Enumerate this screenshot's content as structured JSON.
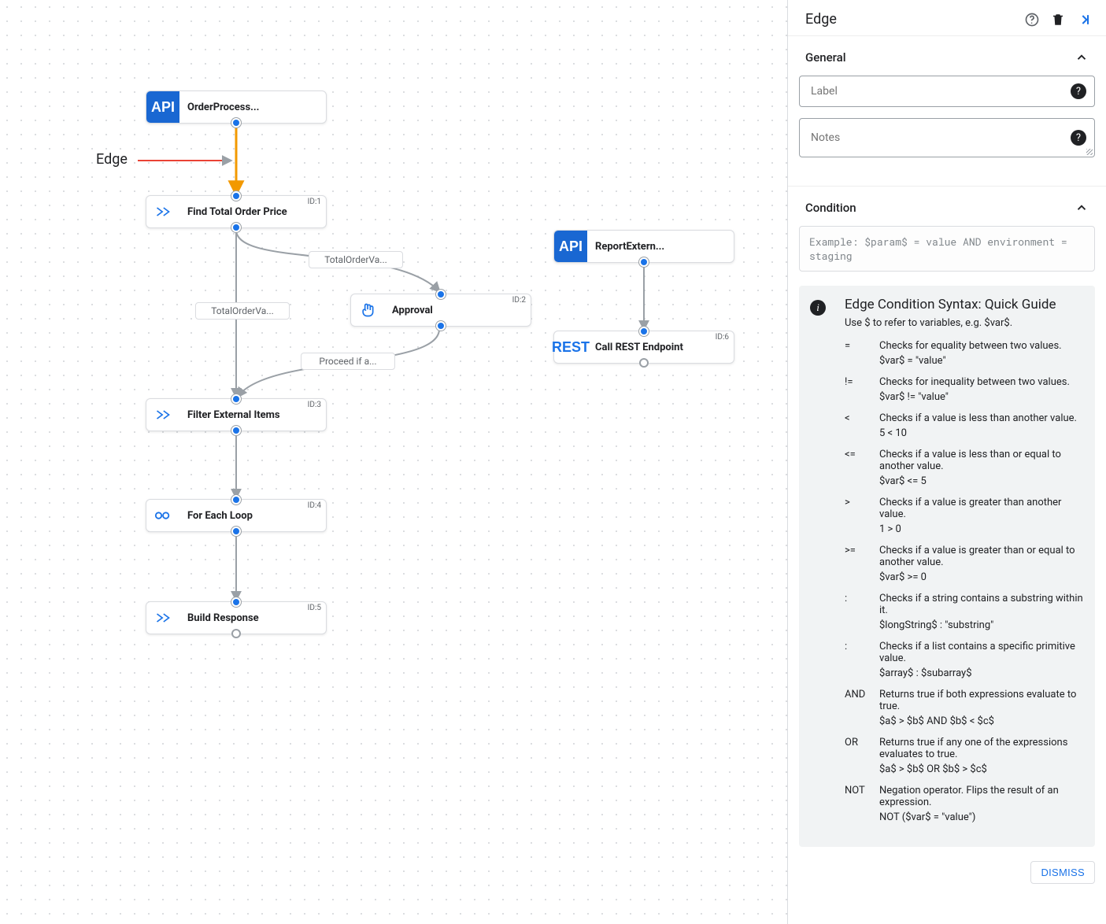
{
  "canvas": {
    "callout": "Edge",
    "nodes": {
      "order": {
        "label": "OrderProcess...",
        "kind": "api"
      },
      "find": {
        "label": "Find Total Order Price",
        "kind": "task",
        "id": "ID:1"
      },
      "approve": {
        "label": "Approval",
        "kind": "hand",
        "id": "ID:2"
      },
      "filter": {
        "label": "Filter External Items",
        "kind": "task",
        "id": "ID:3"
      },
      "loop": {
        "label": "For Each Loop",
        "kind": "loop",
        "id": "ID:4"
      },
      "build": {
        "label": "Build Response",
        "kind": "task",
        "id": "ID:5"
      },
      "report": {
        "label": "ReportExtern...",
        "kind": "api"
      },
      "rest": {
        "label": "Call REST Endpoint",
        "kind": "rest",
        "id": "ID:6"
      }
    },
    "edgeLabels": {
      "ordval1": "TotalOrderVa...",
      "ordval2": "TotalOrderVa...",
      "proceed": "Proceed if a..."
    }
  },
  "sidebar": {
    "title": "Edge",
    "general": {
      "section": "General",
      "label_ph": "Label",
      "notes_ph": "Notes"
    },
    "condition": {
      "section": "Condition",
      "example": "Example: $param$ = value AND environment = staging"
    },
    "guide": {
      "title": "Edge Condition Syntax: Quick Guide",
      "subtitle": "Use $ to refer to variables, e.g. $var$.",
      "ops": [
        {
          "op": "=",
          "desc": "Checks for equality between two values.",
          "ex": "$var$ = \"value\""
        },
        {
          "op": "!=",
          "desc": "Checks for inequality between two values.",
          "ex": "$var$ != \"value\""
        },
        {
          "op": "<",
          "desc": "Checks if a value is less than another value.",
          "ex": "5 < 10"
        },
        {
          "op": "<=",
          "desc": "Checks if a value is less than or equal to another value.",
          "ex": "$var$ <= 5"
        },
        {
          "op": ">",
          "desc": "Checks if a value is greater than another value.",
          "ex": "1 > 0"
        },
        {
          "op": ">=",
          "desc": "Checks if a value is greater than or equal to another value.",
          "ex": "$var$ >= 0"
        },
        {
          "op": ":",
          "desc": "Checks if a string contains a substring within it.",
          "ex": "$longString$ : \"substring\""
        },
        {
          "op": ":",
          "desc": "Checks if a list contains a specific primitive value.",
          "ex": "$array$ : $subarray$"
        },
        {
          "op": "AND",
          "desc": "Returns true if both expressions evaluate to true.",
          "ex": "$a$ > $b$ AND $b$ < $c$"
        },
        {
          "op": "OR",
          "desc": "Returns true if any one of the expressions evaluates to true.",
          "ex": "$a$ > $b$ OR $b$ > $c$"
        },
        {
          "op": "NOT",
          "desc": "Negation operator. Flips the result of an expression.",
          "ex": "NOT ($var$ = \"value\")"
        }
      ]
    },
    "dismiss": "DISMISS"
  },
  "chart_data": {
    "type": "flow",
    "title": "Integration flow with selected edge",
    "nodes": [
      {
        "id": "order",
        "label": "OrderProcess...",
        "kind": "API Trigger"
      },
      {
        "id": "find",
        "label": "Find Total Order Price",
        "kind": "Data Mapping",
        "nodeId": 1
      },
      {
        "id": "approve",
        "label": "Approval",
        "kind": "Approval",
        "nodeId": 2
      },
      {
        "id": "filter",
        "label": "Filter External Items",
        "kind": "Data Mapping",
        "nodeId": 3
      },
      {
        "id": "loop",
        "label": "For Each Loop",
        "kind": "For Each Loop",
        "nodeId": 4
      },
      {
        "id": "build",
        "label": "Build Response",
        "kind": "Data Mapping",
        "nodeId": 5
      },
      {
        "id": "report",
        "label": "ReportExtern...",
        "kind": "API Trigger"
      },
      {
        "id": "rest",
        "label": "Call REST Endpoint",
        "kind": "REST",
        "nodeId": 6
      }
    ],
    "edges": [
      {
        "from": "order",
        "to": "find",
        "label": null,
        "selected": true
      },
      {
        "from": "find",
        "to": "filter",
        "label": "TotalOrderVa..."
      },
      {
        "from": "find",
        "to": "approve",
        "label": "TotalOrderVa..."
      },
      {
        "from": "approve",
        "to": "filter",
        "label": "Proceed if a..."
      },
      {
        "from": "filter",
        "to": "loop",
        "label": null
      },
      {
        "from": "loop",
        "to": "build",
        "label": null
      },
      {
        "from": "report",
        "to": "rest",
        "label": null
      }
    ]
  }
}
